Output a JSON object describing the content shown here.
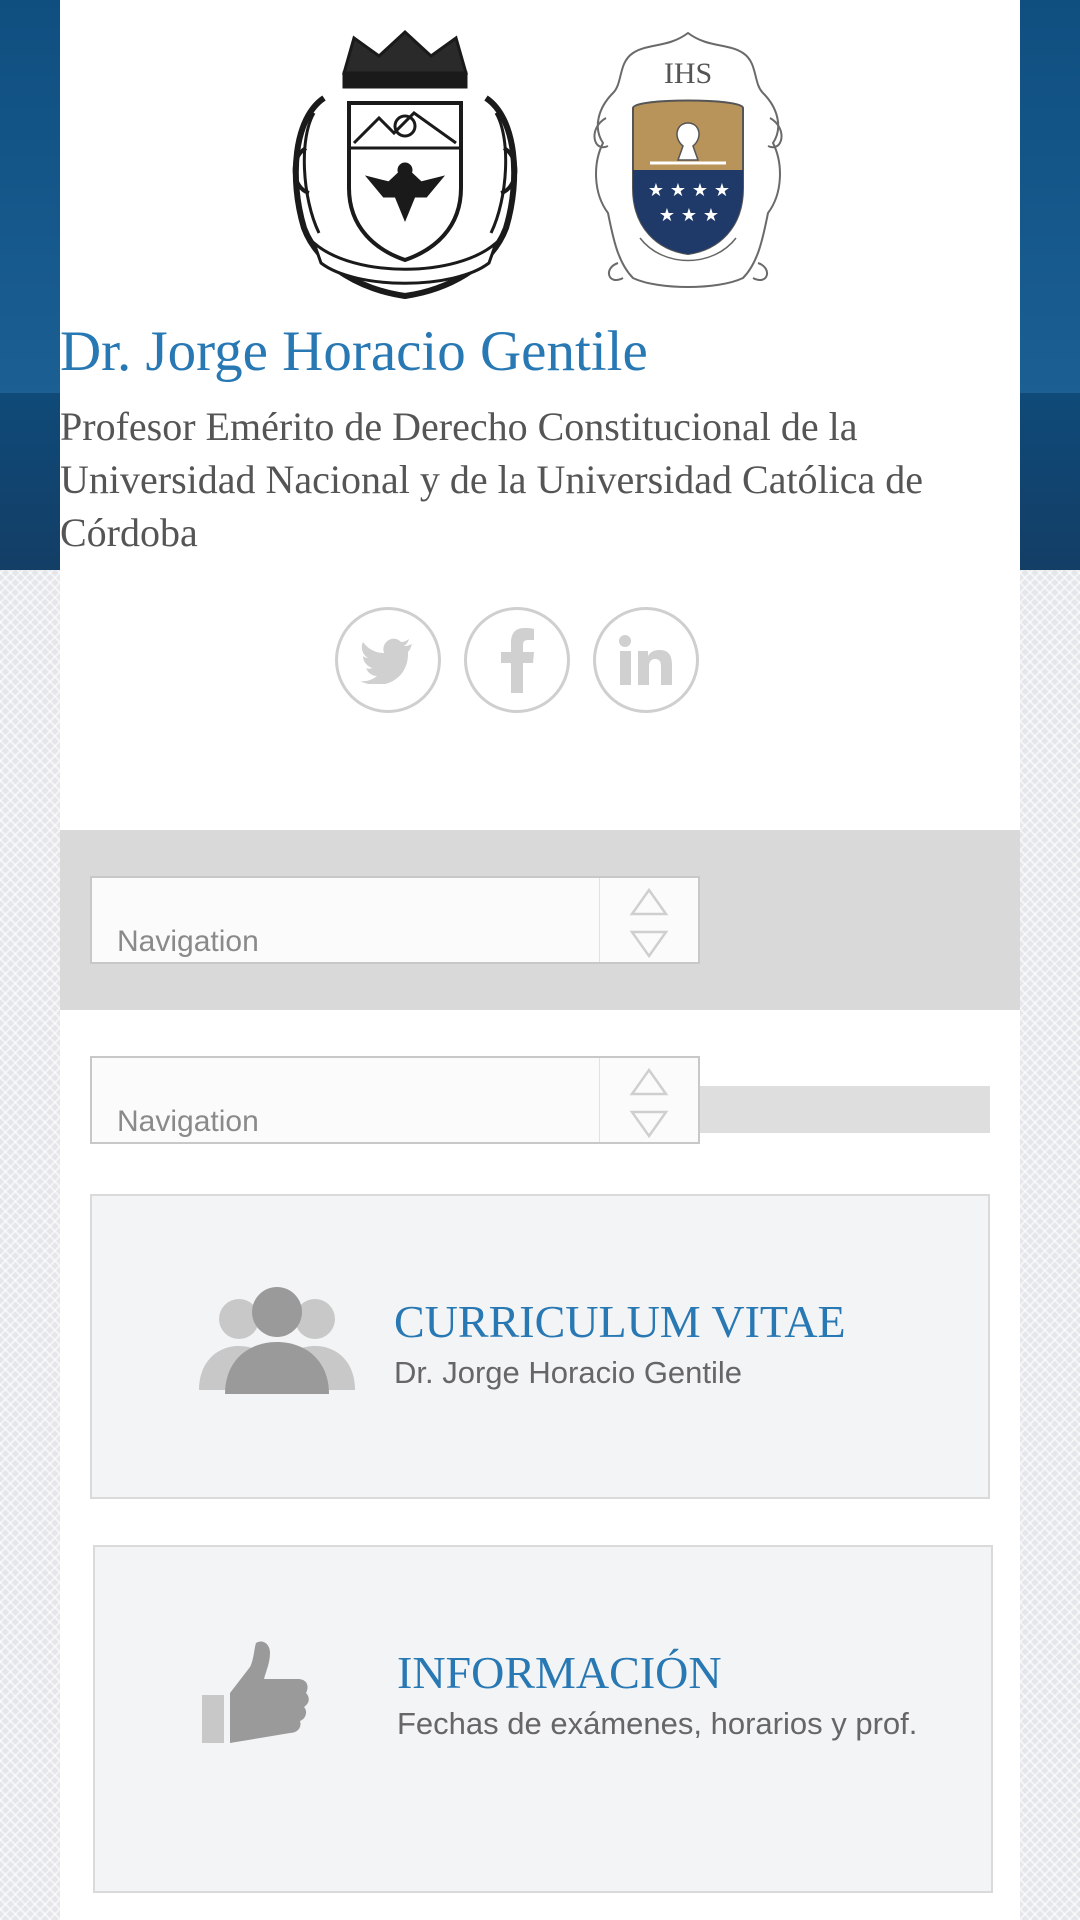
{
  "header": {
    "title": "Dr. Jorge Horacio Gentile",
    "subtitle": "Profesor Emérito de Derecho Constitucional de la Universidad Nacional y de la Universidad Católica de Córdoba"
  },
  "logos": [
    {
      "name": "unc-coat-of-arms",
      "alt": ""
    },
    {
      "name": "ucc-seal",
      "alt": ""
    }
  ],
  "social": [
    {
      "name": "twitter",
      "icon": "twitter-icon"
    },
    {
      "name": "facebook",
      "icon": "facebook-icon"
    },
    {
      "name": "linkedin",
      "icon": "linkedin-icon"
    }
  ],
  "nav": {
    "primary_label": "Navigation",
    "secondary_label": "Navigation"
  },
  "cards": [
    {
      "title": "CURRICULUM VITAE",
      "subtitle": "Dr. Jorge Horacio Gentile",
      "icon": "users-icon"
    },
    {
      "title": "INFORMACIÓN",
      "subtitle": "Fechas de exámenes, horarios y prof.",
      "icon": "thumbs-up-icon"
    }
  ],
  "colors": {
    "accent": "#2878b4",
    "header_band": "#1b5f93",
    "ucc_gold": "#b8935a",
    "ucc_navy": "#1f3a68"
  }
}
